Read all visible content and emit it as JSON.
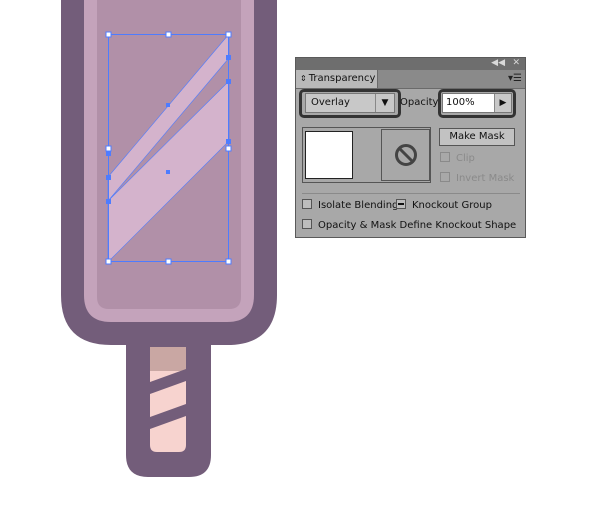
{
  "colors": {
    "popsicle_outline": "#735d7a",
    "popsicle_rim": "#c4a3bb",
    "popsicle_body": "#b190a8",
    "stripe_fill": "#d4b3cc",
    "stick_top": "#c9a7a3",
    "stick_body": "#f7d3cf",
    "selection_blue": "#4e7cff",
    "panel_bg": "#a8a8a8"
  },
  "panel": {
    "tab_label": "Transparency",
    "collapse_icon": "double-chevron-left-icon",
    "close_icon": "close-icon",
    "menu_icon": "panel-menu-icon",
    "blend_mode": "Overlay",
    "opacity_label": "Opacity:",
    "opacity_value": "100%",
    "make_mask_label": "Make Mask",
    "clip_label": "Clip",
    "invert_mask_label": "Invert Mask",
    "isolate_blending_label": "Isolate Blending",
    "knockout_group_label": "Knockout Group",
    "opacity_mask_label": "Opacity & Mask Define Knockout Shape",
    "isolate_blending_checked": false,
    "knockout_group_state": "mixed",
    "opacity_mask_checked": false,
    "clip_enabled": false,
    "invert_mask_enabled": false
  }
}
